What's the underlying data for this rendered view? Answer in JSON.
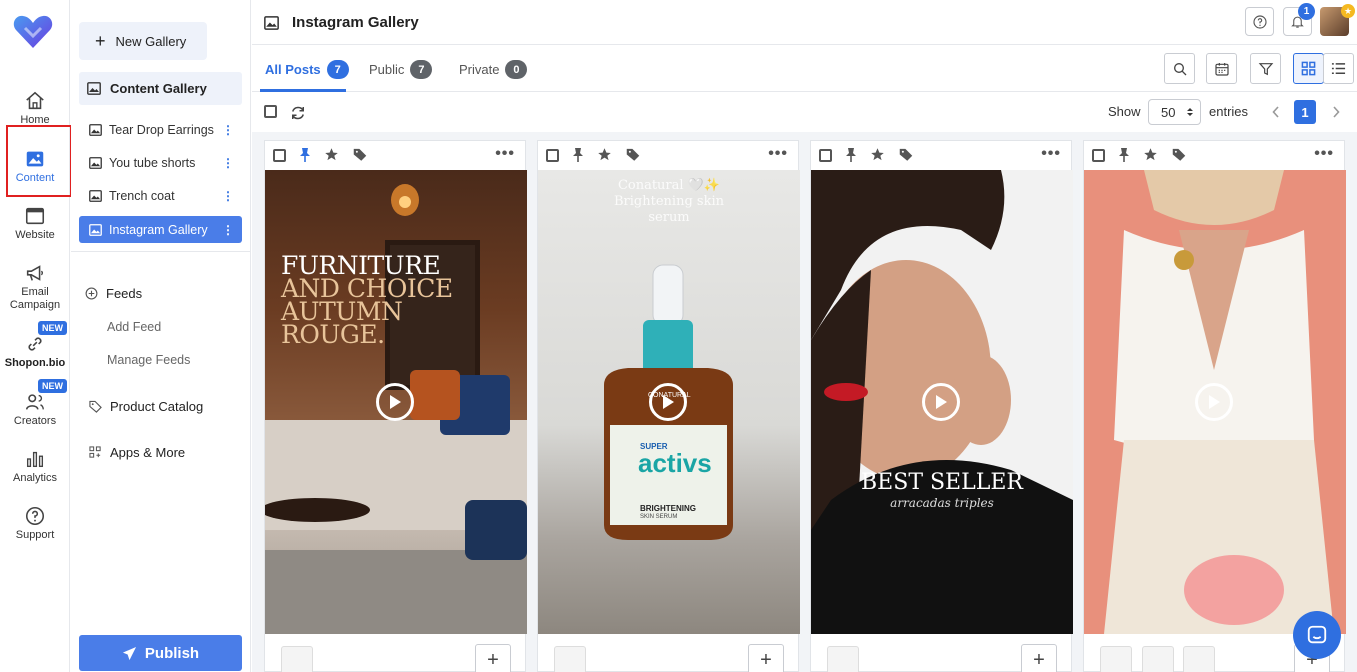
{
  "rail": {
    "items": [
      {
        "label": "Home",
        "icon": "home-icon"
      },
      {
        "label": "Content",
        "icon": "image-icon"
      },
      {
        "label": "Website",
        "icon": "browser-icon"
      },
      {
        "label_line1": "Email",
        "label_line2": "Campaign",
        "icon": "megaphone-icon"
      },
      {
        "label": "Shopon.bio",
        "icon": "link-icon",
        "badge": "NEW"
      },
      {
        "label": "Creators",
        "icon": "users-icon",
        "badge": "NEW"
      },
      {
        "label": "Analytics",
        "icon": "bar-chart-icon"
      },
      {
        "label": "Support",
        "icon": "help-icon"
      }
    ]
  },
  "panel": {
    "new_gallery": "New Gallery",
    "content_gallery": "Content Gallery",
    "galleries": [
      "Tear Drop Earrings",
      "You tube shorts",
      "Trench coat",
      "Instagram Gallery"
    ],
    "feeds": "Feeds",
    "add_feed": "Add Feed",
    "manage_feeds": "Manage Feeds",
    "product_catalog": "Product Catalog",
    "apps_more": "Apps & More",
    "publish": "Publish"
  },
  "header": {
    "title": "Instagram Gallery",
    "notification_count": "1"
  },
  "tabs": [
    {
      "label": "All Posts",
      "count": "7"
    },
    {
      "label": "Public",
      "count": "7"
    },
    {
      "label": "Private",
      "count": "0"
    }
  ],
  "list": {
    "show": "Show",
    "entries_value": "50",
    "entries": "entries",
    "page": "1"
  },
  "cards": [
    {
      "overlay": [
        "FURNITURE",
        "AND CHOICE",
        "AUTUMN",
        "ROUGE."
      ]
    },
    {
      "overlay": [
        "Conatural 🤍✨",
        "Brightening skin",
        "serum"
      ],
      "product_brand": "CONATURAL",
      "product_super": "SUPER",
      "product_name": "activs",
      "product_line": "BRIGHTENING",
      "product_sub": "SKIN SERUM"
    },
    {
      "overlay": [
        "BEST SELLER",
        "arracadas triples"
      ]
    },
    {
      "overlay": []
    }
  ],
  "colors": {
    "accent": "#2f6fe0",
    "highlight": "#e02020"
  }
}
